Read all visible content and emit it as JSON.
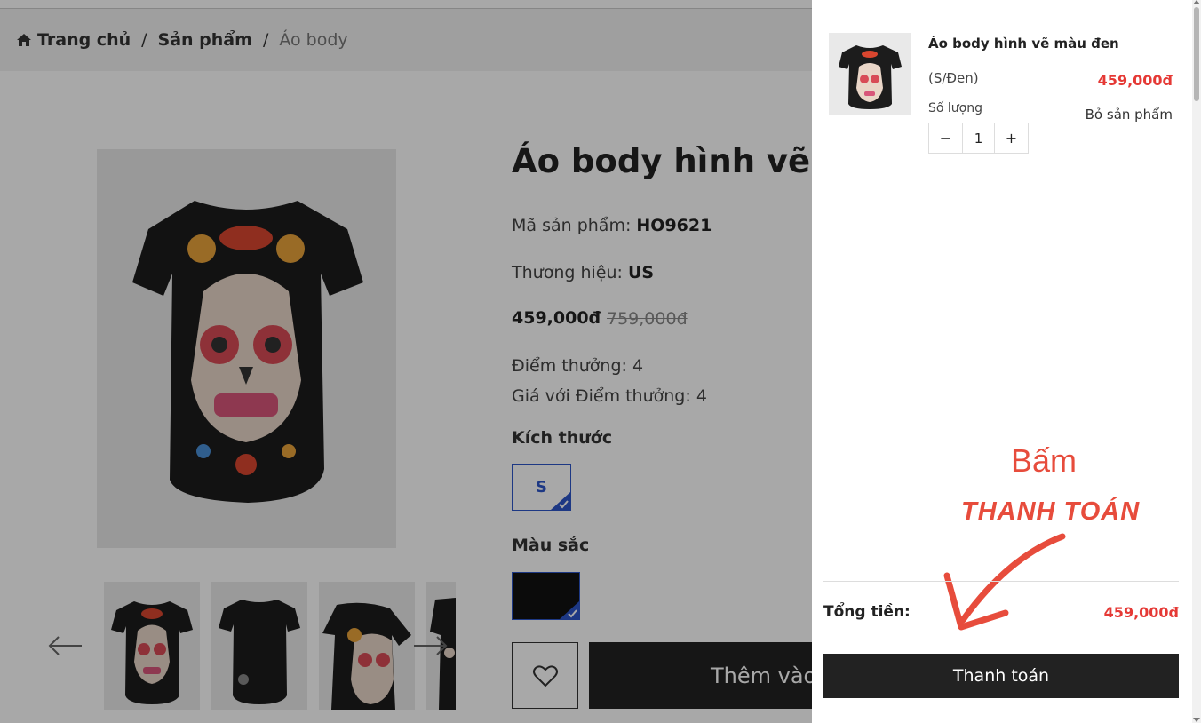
{
  "breadcrumb": {
    "home": "Trang chủ",
    "separator_1": "/",
    "products": "Sản phẩm",
    "separator_2": "/",
    "current": "Áo body"
  },
  "product": {
    "title": "Áo body hình vẽ m",
    "sku_label": "Mã sản phẩm: ",
    "sku": "HO9621",
    "brand_label": "Thương hiệu: ",
    "brand": "US",
    "price": "459,000đ",
    "old_price": "759,000đ",
    "points": "Điểm thưởng: 4",
    "points_price": "Giá với Điểm thưởng: 4",
    "size_label": "Kích thước",
    "size_selected": "S",
    "color_label": "Màu sắc",
    "color_selected": "#111111",
    "add_to_cart": "Thêm vào"
  },
  "cart": {
    "item": {
      "name": "Áo body hình vẽ màu đen",
      "variant": "(S/Đen)",
      "price": "459,000đ",
      "qty_label": "Số lượng",
      "qty": "1",
      "minus": "−",
      "plus": "+",
      "remove": "Bỏ sản phẩm"
    },
    "total_label": "Tổng tiền:",
    "total_value": "459,000đ",
    "checkout": "Thanh toán"
  },
  "annotation": {
    "line1": "Bấm",
    "line2": "THANH TOÁN",
    "color": "#e74c3c"
  },
  "colors": {
    "accent_red": "#e53935",
    "button_dark": "#222222",
    "selected_border": "#2d55c8"
  }
}
